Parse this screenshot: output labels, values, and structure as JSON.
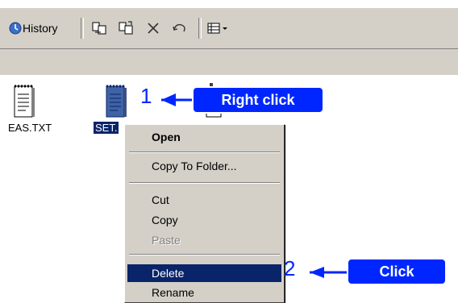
{
  "toolbar": {
    "history_label": "History",
    "buttons": [
      "move-to-icon",
      "copy-to-icon",
      "delete-icon",
      "undo-icon",
      "views-icon"
    ]
  },
  "files": [
    {
      "name": "EAS.TXT",
      "selected": false
    },
    {
      "name": "SET.",
      "selected": true
    }
  ],
  "context_menu": {
    "items": [
      {
        "label": "Open",
        "bold": true
      },
      {
        "label": "Copy To Folder...",
        "bold": false
      },
      {
        "label": "Cut",
        "bold": false
      },
      {
        "label": "Copy",
        "bold": false
      },
      {
        "label": "Paste",
        "bold": false,
        "disabled": true
      },
      {
        "label": "Delete",
        "highlighted": true
      },
      {
        "label": "Rename",
        "bold": false
      }
    ]
  },
  "annotations": {
    "step1_number": "1",
    "step1_label": "Right click",
    "step2_number": "2",
    "step2_label": "Click",
    "color": "#0026ff"
  }
}
